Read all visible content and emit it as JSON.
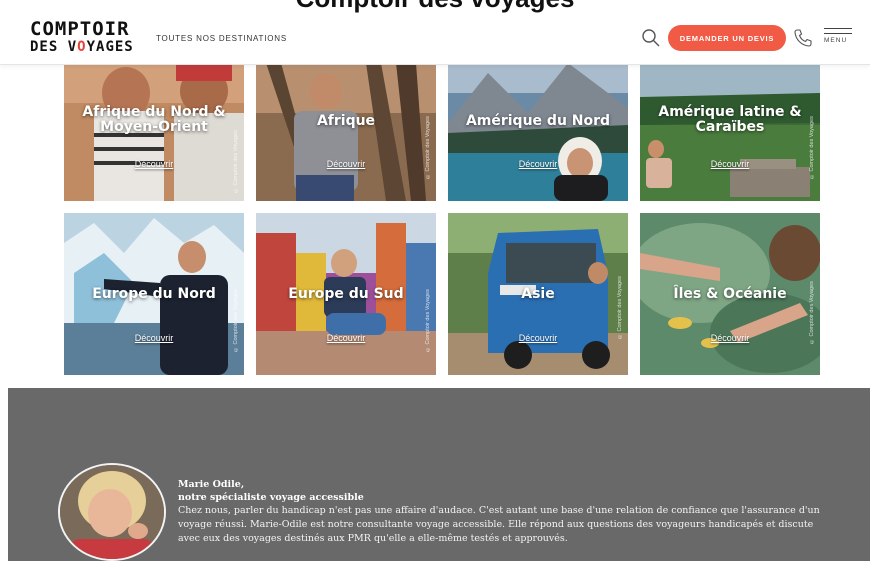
{
  "page": {
    "caption": "Comptoir des voyages"
  },
  "header": {
    "logo_line1": "COMPTOIR",
    "logo_line2_a": "DES V",
    "logo_line2_b": "O",
    "logo_line2_c": "YAGES",
    "nav_destinations": "TOUTES NOS DESTINATIONS",
    "quote_button": "DEMANDER UN DEVIS",
    "menu_label": "MENU",
    "icons": [
      "search-icon",
      "phone-icon",
      "hamburger-menu-icon"
    ],
    "accent_color": "#f15a45"
  },
  "destinations": [
    {
      "title": "Afrique du Nord & Moyen-Orient",
      "link": "Découvrir",
      "credit": "© Comptoir des Voyages"
    },
    {
      "title": "Afrique",
      "link": "Découvrir",
      "credit": "© Comptoir des Voyages"
    },
    {
      "title": "Amérique du Nord",
      "link": "Découvrir",
      "credit": ""
    },
    {
      "title": "Amérique latine & Caraïbes",
      "link": "Découvrir",
      "credit": "© Comptoir des Voyages"
    },
    {
      "title": "Europe du Nord",
      "link": "Découvrir",
      "credit": "© Comptoir des Voyages"
    },
    {
      "title": "Europe du Sud",
      "link": "Découvrir",
      "credit": "© Comptoir des Voyages"
    },
    {
      "title": "Asie",
      "link": "Découvrir",
      "credit": "© Comptoir des Voyages"
    },
    {
      "title": "Îles & Océanie",
      "link": "Découvrir",
      "credit": "© Comptoir des Voyages"
    }
  ],
  "specialist": {
    "name": "Marie Odile,",
    "role": "notre spécialiste voyage accessible",
    "description": "Chez nous, parler du handicap n'est pas une affaire d'audace. C'est autant une base d'une relation de confiance que l'assurance d'un voyage réussi. Marie-Odile est notre consultante voyage accessible. Elle répond aux questions des voyageurs handicapés et discute avec eux des voyages destinés aux PMR qu'elle a elle-même testés et approuvés."
  }
}
